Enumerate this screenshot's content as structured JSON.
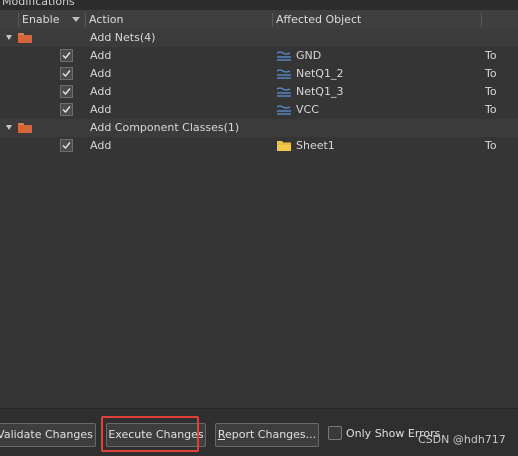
{
  "panel": {
    "title": "Modifications"
  },
  "columns": {
    "enable": "Enable",
    "action": "Action",
    "affected_object": "Affected Object"
  },
  "groups": [
    {
      "label": "Add Nets(4)",
      "items": [
        {
          "action": "Add",
          "object": "GND",
          "icon": "net-icon",
          "to": "To"
        },
        {
          "action": "Add",
          "object": "NetQ1_2",
          "icon": "net-icon",
          "to": "To"
        },
        {
          "action": "Add",
          "object": "NetQ1_3",
          "icon": "net-icon",
          "to": "To"
        },
        {
          "action": "Add",
          "object": "VCC",
          "icon": "net-icon",
          "to": "To"
        }
      ]
    },
    {
      "label": "Add Component Classes(1)",
      "items": [
        {
          "action": "Add",
          "object": "Sheet1",
          "icon": "sheet-icon",
          "to": "To"
        }
      ]
    }
  ],
  "buttons": {
    "validate": "Validate Changes",
    "execute": "Execute Changes",
    "report_underlined": "R",
    "report_rest": "eport Changes..."
  },
  "only_show_errors": {
    "label": "Only Show Errors",
    "checked": false
  },
  "watermark": "CSDN @hdh717",
  "colors": {
    "background": "#353535",
    "highlight": "#e0403a",
    "folder": "#d8643a",
    "net_icon": "#5b8fd6",
    "sheet_icon": "#f2c84b"
  }
}
